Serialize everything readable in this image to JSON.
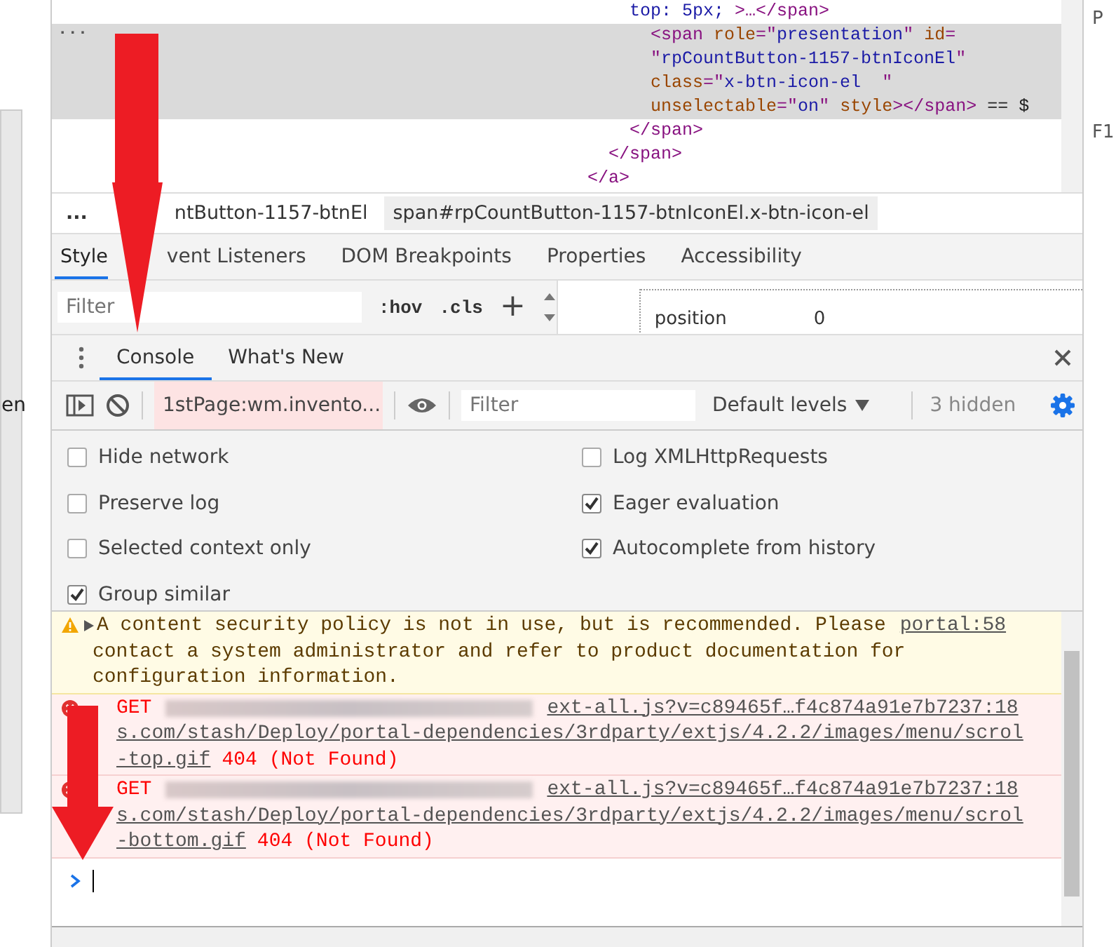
{
  "side_left": {
    "label": "en"
  },
  "side_right": {
    "labels": [
      "P",
      "F1"
    ]
  },
  "elements": {
    "lines": [
      {
        "selected": false,
        "tokens": [
          {
            "kind": "val",
            "text": "    top: 5px; "
          },
          {
            "kind": "tag",
            "text": ">…</span>"
          }
        ]
      },
      {
        "selected": true,
        "tokens": [
          {
            "kind": "tag",
            "text": "      <span "
          },
          {
            "kind": "attr",
            "text": "role"
          },
          {
            "kind": "tag",
            "text": "=\""
          },
          {
            "kind": "val",
            "text": "presentation"
          },
          {
            "kind": "tag",
            "text": "\" "
          },
          {
            "kind": "attr",
            "text": "id"
          },
          {
            "kind": "tag",
            "text": "="
          }
        ]
      },
      {
        "selected": true,
        "tokens": [
          {
            "kind": "tag",
            "text": "      \""
          },
          {
            "kind": "val",
            "text": "rpCountButton-1157-btnIconEl"
          },
          {
            "kind": "tag",
            "text": "\""
          }
        ]
      },
      {
        "selected": true,
        "tokens": [
          {
            "kind": "attr",
            "text": "      class"
          },
          {
            "kind": "tag",
            "text": "=\""
          },
          {
            "kind": "val",
            "text": "x-btn-icon-el  "
          },
          {
            "kind": "tag",
            "text": "\""
          }
        ]
      },
      {
        "selected": true,
        "tokens": [
          {
            "kind": "attr",
            "text": "      unselectable"
          },
          {
            "kind": "tag",
            "text": "=\""
          },
          {
            "kind": "val",
            "text": "on"
          },
          {
            "kind": "tag",
            "text": "\" "
          },
          {
            "kind": "attr",
            "text": "style"
          },
          {
            "kind": "tag",
            "text": "></span>"
          },
          {
            "kind": "text",
            "text": " == $"
          }
        ]
      },
      {
        "selected": false,
        "tokens": [
          {
            "kind": "tag",
            "text": "    </span>"
          }
        ]
      },
      {
        "selected": false,
        "tokens": [
          {
            "kind": "tag",
            "text": "  </span>"
          }
        ]
      },
      {
        "selected": false,
        "tokens": [
          {
            "kind": "tag",
            "text": "</a>"
          }
        ]
      }
    ],
    "ellipsis": "..."
  },
  "breadcrumbs": {
    "ellipsis": "...",
    "items": [
      {
        "label": "ntButton-1157-btnEl",
        "selected": false
      },
      {
        "label": "span#rpCountButton-1157-btnIconEl.x-btn-icon-el",
        "selected": true
      }
    ]
  },
  "side_tabs": [
    {
      "label": "Style",
      "selected": true
    },
    {
      "label": "vent Listeners",
      "selected": false
    },
    {
      "label": "DOM Breakpoints",
      "selected": false
    },
    {
      "label": "Properties",
      "selected": false
    },
    {
      "label": "Accessibility",
      "selected": false
    }
  ],
  "styles_toolbar": {
    "filter_placeholder": "Filter",
    "hov": ":hov",
    "cls": ".cls",
    "add": "+"
  },
  "box_model": {
    "label": "position",
    "value": "0"
  },
  "drawer_tabs": [
    {
      "label": "Console",
      "selected": true
    },
    {
      "label": "What's New",
      "selected": false
    }
  ],
  "console_toolbar": {
    "context": "1stPage:wm.invento...",
    "filter_placeholder": "Filter",
    "levels": "Default levels",
    "hidden": "3 hidden"
  },
  "settings": [
    {
      "label": "Hide network",
      "checked": false
    },
    {
      "label": "Log XMLHttpRequests",
      "checked": false
    },
    {
      "label": "Preserve log",
      "checked": false
    },
    {
      "label": "Eager evaluation",
      "checked": true
    },
    {
      "label": "Selected context only",
      "checked": false
    },
    {
      "label": "Autocomplete from history",
      "checked": true
    },
    {
      "label": "Group similar",
      "checked": true
    }
  ],
  "messages": [
    {
      "kind": "warning",
      "lines": [
        "A content security policy is not in use, but is recommended. Please",
        "contact a system administrator and refer to product documentation for",
        "configuration information."
      ],
      "source": "portal:58"
    },
    {
      "kind": "error",
      "method": "GET",
      "url_lines": [
        "s.com/stash/Deploy/portal-dependencies/3rdparty/extjs/4.2.2/images/menu/scrol",
        "-top.gif"
      ],
      "status": "404 (Not Found)",
      "source": "ext-all.js?v=c89465f…f4c874a91e7b7237:18"
    },
    {
      "kind": "error",
      "method": "GET",
      "url_lines": [
        "s.com/stash/Deploy/portal-dependencies/3rdparty/extjs/4.2.2/images/menu/scrol",
        "-bottom.gif"
      ],
      "status": "404 (Not Found)",
      "source": "ext-all.js?v=c89465f…f4c874a91e7b7237:18"
    }
  ]
}
